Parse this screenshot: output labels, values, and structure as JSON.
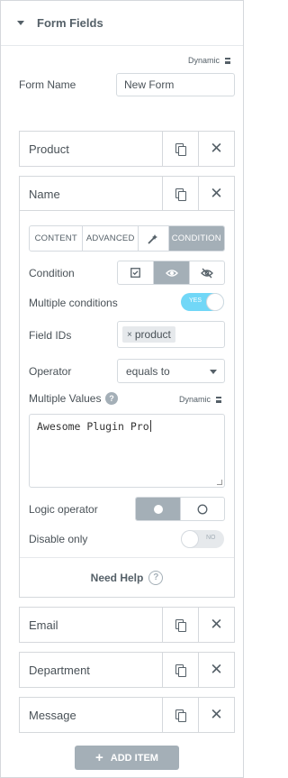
{
  "section": {
    "title": "Form Fields"
  },
  "dynamic_label": "Dynamic",
  "form_name": {
    "label": "Form Name",
    "value": "New Form"
  },
  "items": [
    {
      "label": "Product"
    },
    {
      "label": "Name"
    },
    {
      "label": "Email"
    },
    {
      "label": "Department"
    },
    {
      "label": "Message"
    }
  ],
  "tabs": [
    {
      "label": "CONTENT"
    },
    {
      "label": "ADVANCED"
    },
    {
      "label": "magic-wand-icon"
    },
    {
      "label": "CONDITION",
      "active": true
    }
  ],
  "condition": {
    "label": "Condition",
    "options": [
      "checkbox-icon",
      "eye-icon",
      "eye-slash-icon"
    ],
    "selected": "eye-icon"
  },
  "multiple_conditions": {
    "label": "Multiple conditions",
    "state": "YES",
    "on": true
  },
  "field_ids": {
    "label": "Field IDs",
    "tags": [
      "product"
    ]
  },
  "operator": {
    "label": "Operator",
    "value": "equals to"
  },
  "multiple_values": {
    "label": "Multiple Values",
    "value": "Awesome Plugin Pro"
  },
  "logic_operator": {
    "label": "Logic operator",
    "options": [
      "filled-circle-icon",
      "empty-circle-icon"
    ],
    "selected": "filled-circle-icon"
  },
  "disable_only": {
    "label": "Disable only",
    "state": "NO",
    "on": false
  },
  "need_help": {
    "label": "Need Help"
  },
  "add_item": {
    "label": "ADD ITEM"
  },
  "colors": {
    "accent": "#71d7f7",
    "neutral": "#a4afb7",
    "border": "#d5d8dc"
  }
}
